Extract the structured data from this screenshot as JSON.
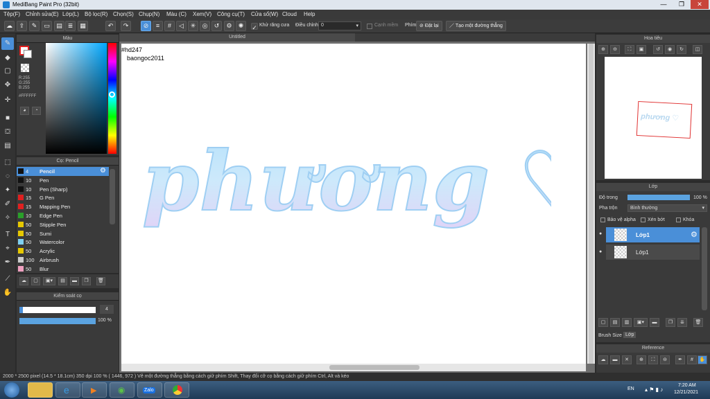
{
  "window": {
    "title": "MediBang Paint Pro (32bit)",
    "minimize": "—",
    "maximize": "❐",
    "close": "✕"
  },
  "menu": [
    "Tệp(F)",
    "Chỉnh sửa(E)",
    "Lớp(L)",
    "Bộ lọc(R)",
    "Chọn(S)",
    "Chụp(N)",
    "Màu (C)",
    "Xem(V)",
    "Công cụ(T)",
    "Cửa sổ(W)",
    "Cloud",
    "Help"
  ],
  "toolbar": {
    "antialias_label": "Khử răng cưa",
    "adjust_label": "Điều chỉnh",
    "adjust_value": "0",
    "edge_label": "Cạnh mềm",
    "key_label": "Phím",
    "reset_label": "Đặt lại",
    "line_label": "Tạo một đường thẳng"
  },
  "color_panel": {
    "title": "Màu",
    "r": "R:255",
    "g": "G:255",
    "b": "B:255",
    "hex": "#FFFFFF",
    "primary_color": "#e02020",
    "secondary_color": "#ffffff"
  },
  "brush_panel": {
    "title": "Cọ: Pencil",
    "items": [
      {
        "size": "4",
        "name": "Pencil",
        "color": "#111111"
      },
      {
        "size": "10",
        "name": "Pen",
        "color": "#111111"
      },
      {
        "size": "10",
        "name": "Pen (Sharp)",
        "color": "#111111"
      },
      {
        "size": "15",
        "name": "G Pen",
        "color": "#e02020"
      },
      {
        "size": "15",
        "name": "Mapping Pen",
        "color": "#e02020"
      },
      {
        "size": "10",
        "name": "Edge Pen",
        "color": "#2aa02a"
      },
      {
        "size": "50",
        "name": "Stipple Pen",
        "color": "#e6c800"
      },
      {
        "size": "50",
        "name": "Sumi",
        "color": "#e6c800"
      },
      {
        "size": "50",
        "name": "Watercolor",
        "color": "#7fd0f0"
      },
      {
        "size": "50",
        "name": "Acrylic",
        "color": "#e6c800"
      },
      {
        "size": "100",
        "name": "Airbrush",
        "color": "#cccccc"
      },
      {
        "size": "50",
        "name": "Blur",
        "color": "#f0a0c0"
      }
    ]
  },
  "brush_control": {
    "title": "Kiểm soát cọ",
    "size_value": "4",
    "opacity_value": "100 %",
    "opacity": 1.0
  },
  "canvas": {
    "tab": "Untitled",
    "text_line1": "#hd247",
    "text_line2": "baongoc2011",
    "art_text": "phương ♡"
  },
  "navigator": {
    "title": "Hoa tiêu",
    "thumb_text": "phương ♡"
  },
  "layer_panel": {
    "title": "Lớp",
    "opacity_label": "Độ trong",
    "opacity_value": "100 %",
    "opacity": 1.0,
    "blend_label": "Pha trộn",
    "blend_value": "Bình thường",
    "protect_alpha": "Bảo vệ alpha",
    "clipping": "Xén bớt",
    "lock": "Khóa",
    "layers": [
      "Lớp1",
      "Lớp1"
    ]
  },
  "right_tabs": {
    "brush_size": "Brush Size",
    "layer": "Lớp"
  },
  "reference": {
    "title": "Reference"
  },
  "status": "2000 * 2500 pixel   (14.5 * 18.1cm)   350 dpi   100 %   ( 1446, 972 )   Vẽ một đường thẳng bằng cách giữ phím Shift, Thay đổi cỡ cọ bằng cách giữ phím Ctrl, Alt và kéo",
  "taskbar": {
    "lang": "EN",
    "time": "7:20 AM",
    "date": "12/21/2021"
  }
}
